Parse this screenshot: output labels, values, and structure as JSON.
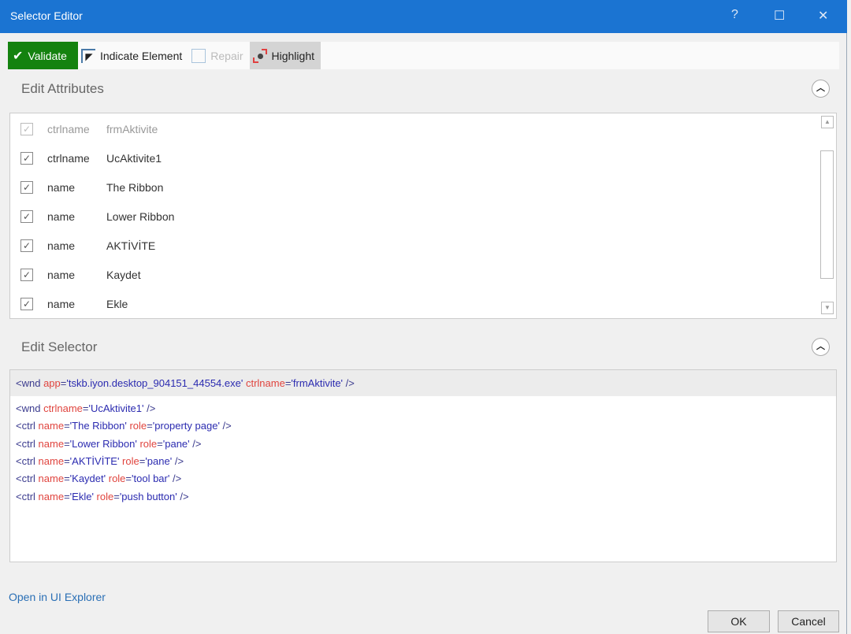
{
  "window": {
    "title": "Selector Editor",
    "help": "?",
    "maximize": "☐",
    "close": "✕"
  },
  "toolbar": {
    "validate": "Validate",
    "indicate": "Indicate Element",
    "repair": "Repair",
    "highlight": "Highlight"
  },
  "attributes": {
    "title": "Edit Attributes",
    "rows": [
      {
        "checked": true,
        "enabled": false,
        "name": "ctrlname",
        "value": "frmAktivite"
      },
      {
        "checked": true,
        "enabled": true,
        "name": "ctrlname",
        "value": "UcAktivite1"
      },
      {
        "checked": true,
        "enabled": true,
        "name": "name",
        "value": "The Ribbon"
      },
      {
        "checked": true,
        "enabled": true,
        "name": "name",
        "value": "Lower Ribbon"
      },
      {
        "checked": true,
        "enabled": true,
        "name": "name",
        "value": "AKTİVİTE"
      },
      {
        "checked": true,
        "enabled": true,
        "name": "name",
        "value": "Kaydet"
      },
      {
        "checked": true,
        "enabled": true,
        "name": "name",
        "value": "Ekle"
      }
    ]
  },
  "selector": {
    "title": "Edit Selector",
    "lines": [
      [
        [
          "tg",
          "<wnd "
        ],
        [
          "an",
          "app"
        ],
        [
          "tg",
          "="
        ],
        [
          "av",
          "'tskb.iyon.desktop_904151_44554.exe' "
        ],
        [
          "an",
          "ctrlname"
        ],
        [
          "tg",
          "="
        ],
        [
          "av",
          "'frmAktivite'"
        ],
        [
          "tg",
          " />"
        ]
      ],
      [
        [
          "tg",
          "<wnd "
        ],
        [
          "an",
          "ctrlname"
        ],
        [
          "tg",
          "="
        ],
        [
          "av",
          "'UcAktivite1'"
        ],
        [
          "tg",
          " />"
        ]
      ],
      [
        [
          "tg",
          "<ctrl "
        ],
        [
          "an",
          "name"
        ],
        [
          "tg",
          "="
        ],
        [
          "av",
          "'The Ribbon' "
        ],
        [
          "an",
          "role"
        ],
        [
          "tg",
          "="
        ],
        [
          "av",
          "'property page'"
        ],
        [
          "tg",
          " />"
        ]
      ],
      [
        [
          "tg",
          "<ctrl "
        ],
        [
          "an",
          "name"
        ],
        [
          "tg",
          "="
        ],
        [
          "av",
          "'Lower Ribbon' "
        ],
        [
          "an",
          "role"
        ],
        [
          "tg",
          "="
        ],
        [
          "av",
          "'pane'"
        ],
        [
          "tg",
          " />"
        ]
      ],
      [
        [
          "tg",
          "<ctrl "
        ],
        [
          "an",
          "name"
        ],
        [
          "tg",
          "="
        ],
        [
          "av",
          "'AKTİVİTE' "
        ],
        [
          "an",
          "role"
        ],
        [
          "tg",
          "="
        ],
        [
          "av",
          "'pane'"
        ],
        [
          "tg",
          " />"
        ]
      ],
      [
        [
          "tg",
          "<ctrl "
        ],
        [
          "an",
          "name"
        ],
        [
          "tg",
          "="
        ],
        [
          "av",
          "'Kaydet' "
        ],
        [
          "an",
          "role"
        ],
        [
          "tg",
          "="
        ],
        [
          "av",
          "'tool bar'"
        ],
        [
          "tg",
          " />"
        ]
      ],
      [
        [
          "tg",
          "<ctrl "
        ],
        [
          "an",
          "name"
        ],
        [
          "tg",
          "="
        ],
        [
          "av",
          "'Ekle' "
        ],
        [
          "an",
          "role"
        ],
        [
          "tg",
          "="
        ],
        [
          "av",
          "'push button'"
        ],
        [
          "tg",
          " />"
        ]
      ]
    ]
  },
  "footer": {
    "explorer_link": "Open in UI Explorer",
    "ok": "OK",
    "cancel": "Cancel"
  },
  "colors": {
    "titlebar": "#1b74d2",
    "validate": "#14820f",
    "attr_name": "#e0443e",
    "attr_value": "#2b2bb0",
    "tag": "#3b3b8e"
  }
}
